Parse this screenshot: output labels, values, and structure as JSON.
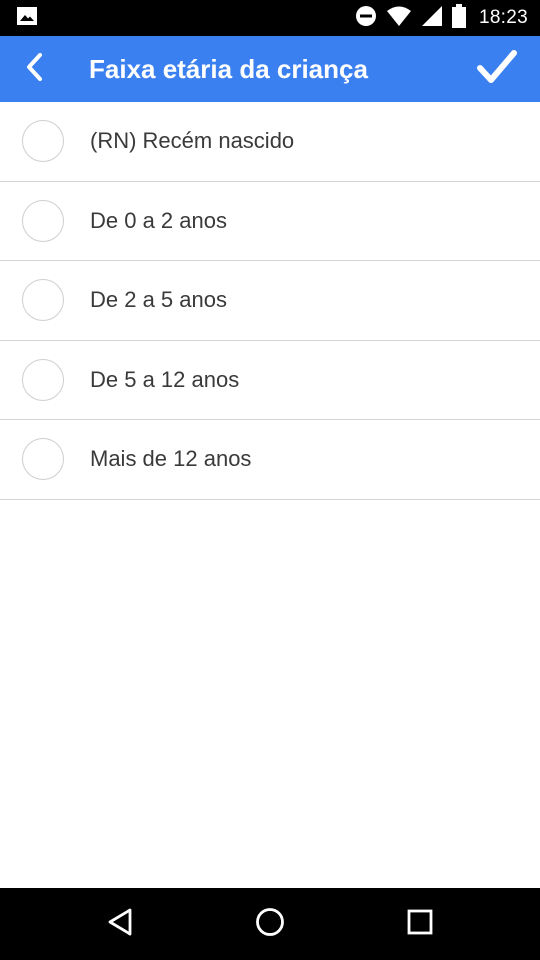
{
  "status_bar": {
    "time": "18:23",
    "icons": [
      "image-notification-icon",
      "do-not-disturb-icon",
      "wifi-icon",
      "signal-icon",
      "battery-icon"
    ]
  },
  "app_bar": {
    "title": "Faixa etária da criança",
    "back_icon": "chevron-left-icon",
    "confirm_icon": "checkmark-icon",
    "color": "#3b80f0"
  },
  "options": [
    {
      "label": "(RN) Recém nascido",
      "selected": false
    },
    {
      "label": "De 0 a 2 anos",
      "selected": false
    },
    {
      "label": "De 2 a 5 anos",
      "selected": false
    },
    {
      "label": "De 5 a 12 anos",
      "selected": false
    },
    {
      "label": "Mais de 12 anos",
      "selected": false
    }
  ],
  "nav_bar": {
    "icons": [
      "back-triangle-icon",
      "home-circle-icon",
      "recents-square-icon"
    ]
  }
}
